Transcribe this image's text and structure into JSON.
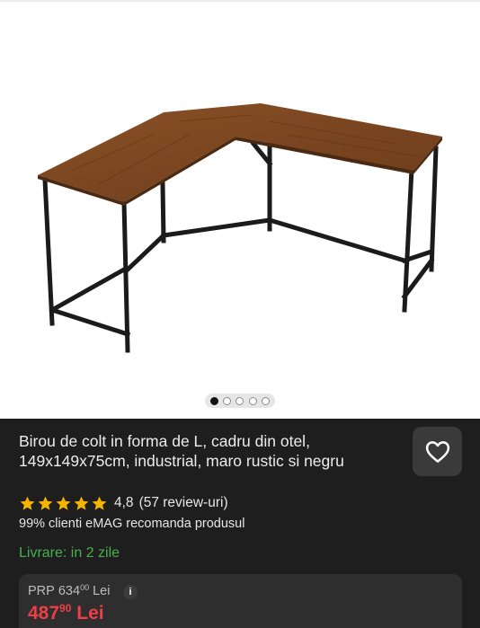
{
  "product": {
    "title": "Birou de colt in forma de L, cadru din otel, 149x149x75cm, industrial, maro rustic si negru",
    "rating": "4,8",
    "reviews": "(57 review-uri)",
    "stars": 5,
    "recommend": "99% clienti eMAG recomanda produsul",
    "delivery": "Livrare: in 2 zile"
  },
  "gallery": {
    "image_count": 5,
    "active_index": 0,
    "image_icon": "l-shaped-desk"
  },
  "prp": {
    "label": "PRP",
    "int": "634",
    "dec": "00",
    "currency": "Lei"
  },
  "price": {
    "int": "487",
    "dec": "90",
    "currency": "Lei"
  },
  "icons": {
    "favorite": "heart-outline-icon",
    "info": "info-icon"
  },
  "colors": {
    "panel": "#1e1e1e",
    "price": "#ef3e47",
    "delivery": "#49b04d",
    "star": "#f5b400"
  }
}
